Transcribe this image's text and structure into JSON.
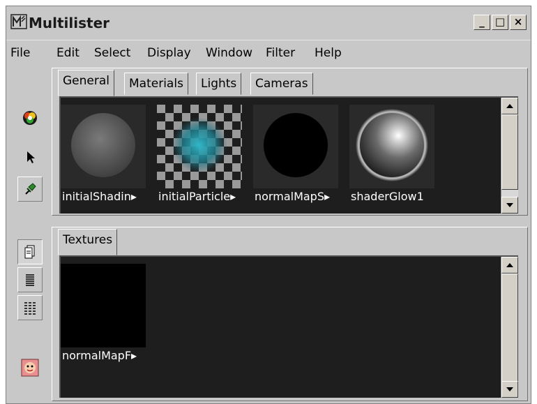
{
  "window": {
    "title": "Multilister",
    "icon": "multilister-app-icon",
    "controls": [
      "minimize",
      "maximize",
      "close"
    ],
    "control_glyphs": {
      "minimize": "_",
      "maximize": "□",
      "close": "×"
    }
  },
  "menubar": {
    "items": [
      "File",
      "Edit",
      "Select",
      "Display",
      "Window",
      "Filter",
      "Help"
    ]
  },
  "toolbar": {
    "tools": [
      "shading-group-icon",
      "select-arrow-icon",
      "pin-icon",
      "icon-view-icon",
      "list-view-icon",
      "detailed-list-icon",
      "face-icon"
    ]
  },
  "top_panel": {
    "tabs": [
      "General",
      "Materials",
      "Lights",
      "Cameras"
    ],
    "active_tab": "General",
    "swatches": [
      {
        "label": "initialShadin",
        "preview": "gray-sphere",
        "truncated": true
      },
      {
        "label": "initialParticle",
        "preview": "checker-cyan-glow",
        "truncated": true
      },
      {
        "label": "normalMapS",
        "preview": "black-sphere",
        "truncated": true
      },
      {
        "label": "shaderGlow1",
        "preview": "shiny-sphere",
        "truncated": false
      }
    ]
  },
  "bottom_panel": {
    "tabs": [
      "Textures"
    ],
    "active_tab": "Textures",
    "swatches": [
      {
        "label": "normalMapF",
        "preview": "black-square",
        "truncated": true
      }
    ]
  },
  "colors": {
    "chrome": "#c8c8c8",
    "swatch_bg": "#1e1e1e",
    "label_text": "#ffffff",
    "glow_cyan": "#2aa8b8"
  }
}
